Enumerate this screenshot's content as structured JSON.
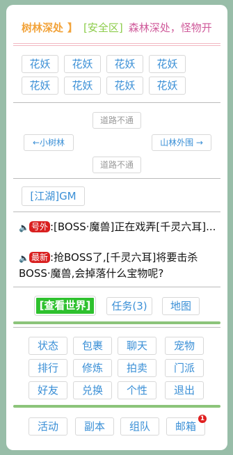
{
  "header": {
    "place": "树林深处",
    "bracket": "】",
    "safe": "[安全区]",
    "desc": "森林深处，怪物开"
  },
  "monsters": [
    "花妖",
    "花妖",
    "花妖",
    "花妖",
    "花妖",
    "花妖",
    "花妖",
    "花妖"
  ],
  "nav": {
    "north": "道路不通",
    "west": "←小树林",
    "east": "山林外围 →",
    "south": "道路不通"
  },
  "npc": "[江湖]GM",
  "messages": [
    {
      "icon": "speaker-icon",
      "tag": "号外",
      "text": ":[BOSS·魔兽]正在戏弄[千灵六耳]..."
    },
    {
      "icon": "speaker-icon",
      "tag": "最新",
      "text": ":抢BOSS了,[千灵六耳]将要击杀BOSS·魔兽,会掉落什么宝物呢?"
    }
  ],
  "toolbar": {
    "world": "[查看世界]",
    "tasks": "任务(3)",
    "map": "地图"
  },
  "menu": [
    "状态",
    "包裹",
    "聊天",
    "宠物",
    "排行",
    "修炼",
    "拍卖",
    "门派",
    "好友",
    "兑换",
    "个性",
    "退出"
  ],
  "bottom": [
    "活动",
    "副本",
    "组队",
    "邮箱"
  ],
  "mail_badge": "1",
  "colors": {
    "background": "#98bda8",
    "link": "#3a8fd6",
    "world": "#2ec12e",
    "tag": "#d92020"
  }
}
